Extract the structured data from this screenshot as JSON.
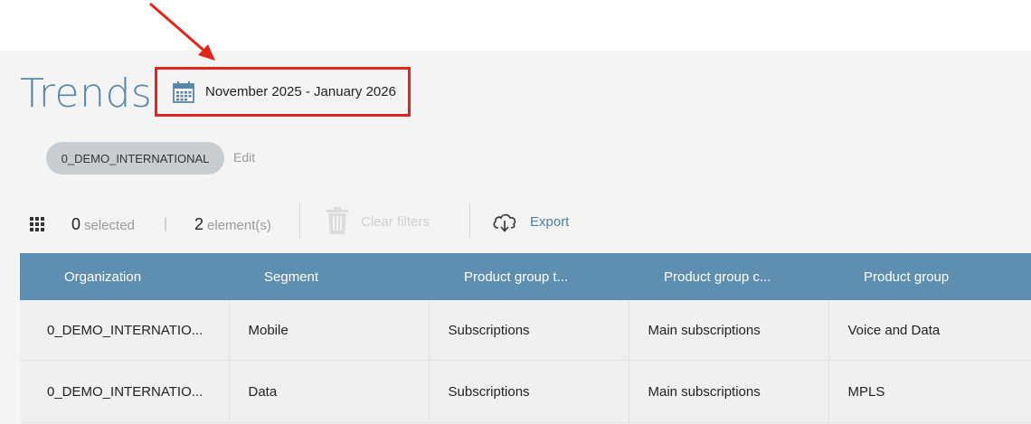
{
  "page": {
    "title": "Trends",
    "date_range": "November 2025 - January 2026"
  },
  "filters": {
    "chip_label": "0_DEMO_INTERNATIONAL",
    "edit_label": "Edit"
  },
  "toolbar": {
    "selected_count": "0",
    "selected_label": "selected",
    "separator": "|",
    "element_count": "2",
    "element_label": "element(s)",
    "clear_filters_label": "Clear filters",
    "export_label": "Export"
  },
  "table": {
    "columns": [
      "Organization",
      "Segment",
      "Product group t...",
      "Product group c...",
      "Product group"
    ],
    "rows": [
      [
        "0_DEMO_INTERNATIO...",
        "Mobile",
        "Subscriptions",
        "Main subscriptions",
        "Voice and Data"
      ],
      [
        "0_DEMO_INTERNATIO...",
        "Data",
        "Subscriptions",
        "Main subscriptions",
        "MPLS"
      ]
    ]
  },
  "colors": {
    "accent": "#5f8fb0",
    "title": "#5a86a6",
    "highlight": "#e1251b"
  },
  "icons": [
    "calendar-icon",
    "grid-icon",
    "trash-icon",
    "cloud-download-icon",
    "annotation-arrow"
  ]
}
